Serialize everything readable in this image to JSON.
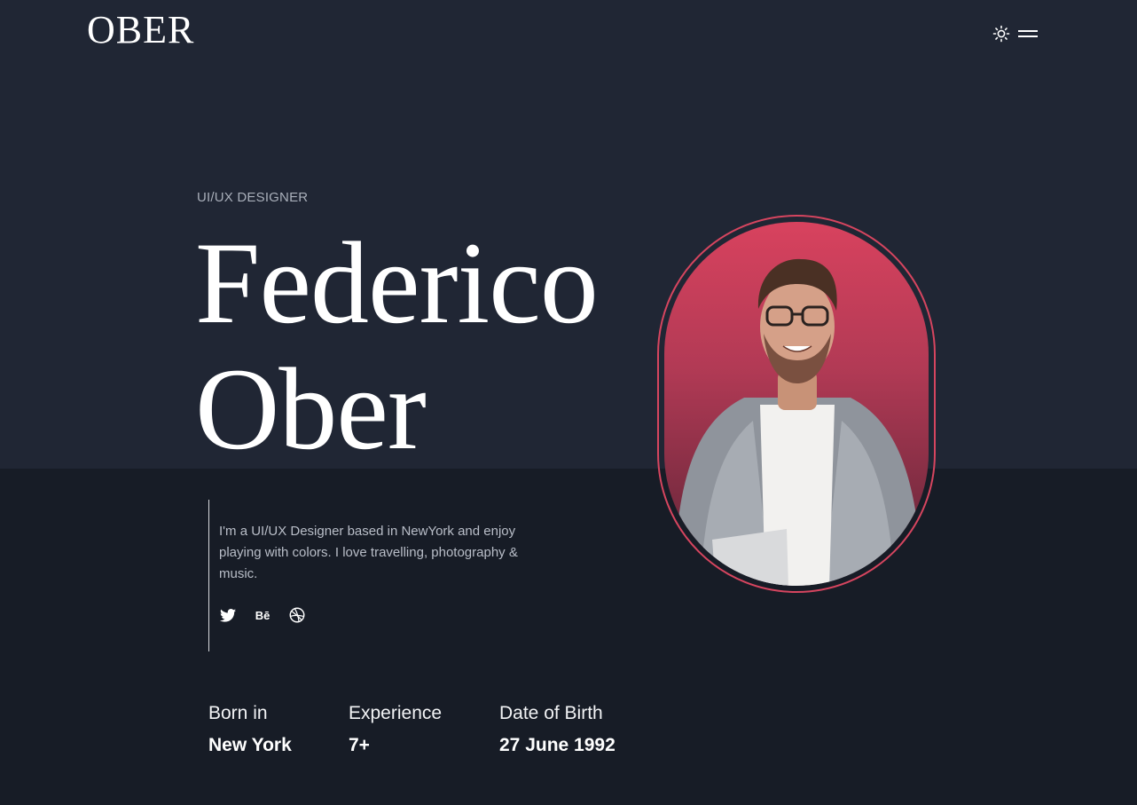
{
  "header": {
    "logo": "OBER",
    "theme_icon": "sun-icon",
    "menu_icon": "hamburger-menu-icon"
  },
  "hero": {
    "role": "UI/UX DESIGNER",
    "first_name": "Federico",
    "last_name": "Ober",
    "bio": "I'm a UI/UX Designer based in NewYork and enjoy playing with colors. I love travelling, photography & music."
  },
  "socials": [
    {
      "name": "twitter-icon"
    },
    {
      "name": "behance-icon",
      "label": "Bē"
    },
    {
      "name": "dribbble-icon"
    }
  ],
  "stats": [
    {
      "label": "Born in",
      "value": "New York"
    },
    {
      "label": "Experience",
      "value": "7+"
    },
    {
      "label": "Date of Birth",
      "value": "27 June 1992"
    }
  ],
  "colors": {
    "accent": "#d6455f",
    "background_top": "#202634",
    "background_bottom": "#171c26",
    "muted_text": "#a9afba"
  }
}
